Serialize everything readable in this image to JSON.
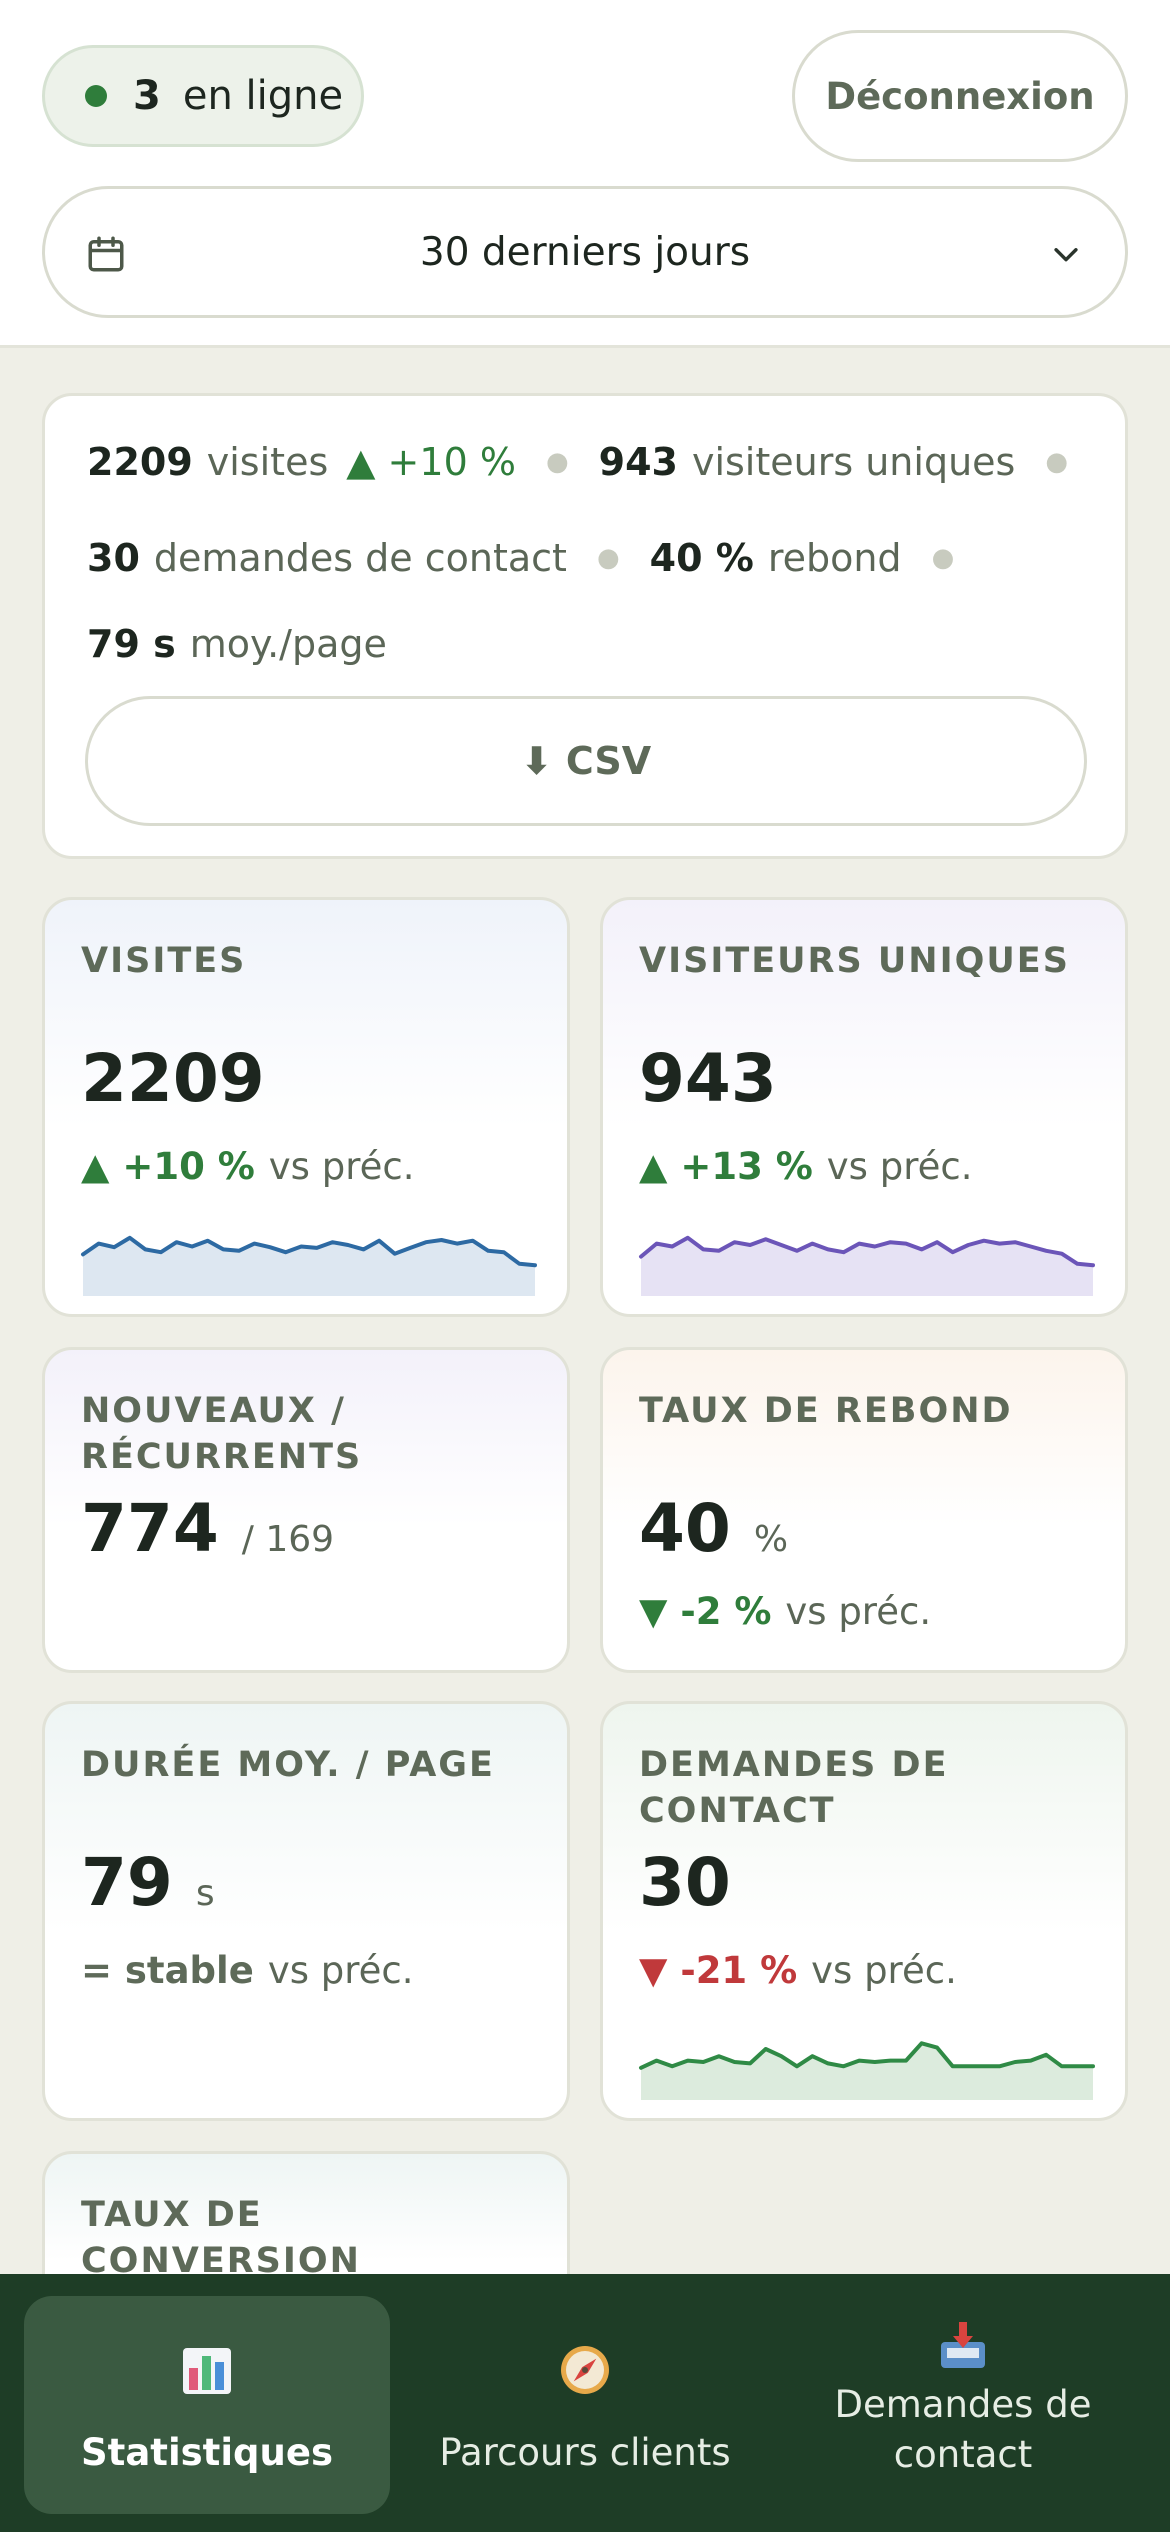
{
  "header": {
    "online_count": "3",
    "online_label": "en ligne",
    "logout_label": "Déconnexion",
    "period_label": "30 derniers jours"
  },
  "summary": {
    "visits_value": "2209",
    "visits_label": "visites",
    "visits_trend": "▲ +10 %",
    "unique_value": "943",
    "unique_label": "visiteurs uniques",
    "contacts_value": "30",
    "contacts_label": "demandes de contact",
    "bounce_value": "40 %",
    "bounce_label": "rebond",
    "time_value": "79 s",
    "time_label": "moy./page",
    "csv_label": "⬇ CSV"
  },
  "kpis": {
    "visits": {
      "title": "Visites",
      "value": "2209",
      "delta": "▲ +10 %",
      "vs": "vs préc."
    },
    "unique": {
      "title": "Visiteurs uniques",
      "value": "943",
      "delta": "▲ +13 %",
      "vs": "vs préc."
    },
    "new_returning": {
      "title": "Nouveaux / récurrents",
      "value": "774",
      "secondary": "/ 169"
    },
    "bounce": {
      "title": "Taux de rebond",
      "value": "40",
      "unit": "%",
      "delta": "▼ -2 %",
      "vs": "vs préc."
    },
    "avg_time": {
      "title": "Durée moy. / page",
      "value": "79",
      "unit": "s",
      "delta": "= stable",
      "vs": "vs préc."
    },
    "contacts": {
      "title": "Demandes de contact",
      "value": "30",
      "delta": "▼ -21 %",
      "vs": "vs préc."
    },
    "conversion": {
      "title": "Taux de conversion"
    }
  },
  "sparklines": {
    "visits": {
      "color": "#2d6aa3",
      "fill": "#dde7f1",
      "values": [
        55,
        70,
        65,
        78,
        62,
        58,
        72,
        66,
        74,
        62,
        60,
        70,
        65,
        58,
        66,
        64,
        72,
        68,
        62,
        74,
        56,
        64,
        72,
        75,
        70,
        74,
        60,
        58,
        42,
        40
      ]
    },
    "unique": {
      "color": "#6b55b8",
      "fill": "#e6e2f4",
      "values": [
        52,
        70,
        66,
        78,
        62,
        60,
        72,
        68,
        76,
        68,
        60,
        70,
        62,
        58,
        70,
        66,
        72,
        70,
        62,
        72,
        58,
        68,
        74,
        70,
        72,
        66,
        60,
        56,
        42,
        40
      ]
    },
    "contacts": {
      "color": "#2f8a45",
      "fill": "#dcebdd",
      "values": [
        42,
        52,
        44,
        52,
        50,
        58,
        50,
        48,
        68,
        58,
        44,
        58,
        48,
        44,
        52,
        50,
        52,
        52,
        76,
        70,
        44,
        44,
        44,
        44,
        50,
        52,
        60,
        44,
        44,
        44
      ]
    }
  },
  "nav": [
    {
      "label": "Statistiques",
      "icon": "bar-chart-icon",
      "active": true
    },
    {
      "label": "Parcours clients",
      "icon": "compass-icon",
      "active": false
    },
    {
      "label": "Demandes de contact",
      "icon": "inbox-tray-icon",
      "active": false
    }
  ]
}
